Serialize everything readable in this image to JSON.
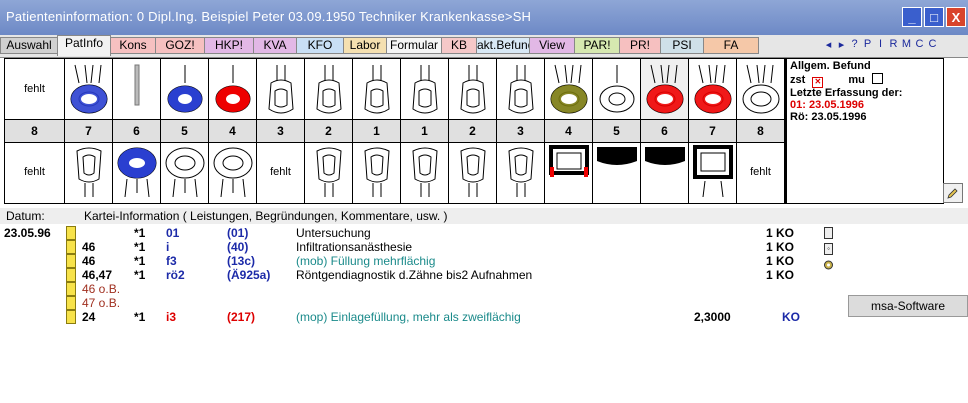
{
  "window": {
    "title": "Patienteninformation: 0  Dipl.Ing. Beispiel Peter  03.09.1950  Techniker Krankenkasse>SH",
    "buttons": [
      "_",
      "□",
      "X"
    ]
  },
  "tabs": [
    {
      "label": "Auswahl",
      "color": "#d0d0d0"
    },
    {
      "label": "PatInfo",
      "color": "#f2f2f2"
    },
    {
      "label": "Kons",
      "color": "#f6c0c0"
    },
    {
      "label": "GOZ!",
      "color": "#f6c0c0"
    },
    {
      "label": "HKP!",
      "color": "#e2b8e6"
    },
    {
      "label": "KVA",
      "color": "#e2b8e6"
    },
    {
      "label": "KFO",
      "color": "#c9dff5"
    },
    {
      "label": "Labor",
      "color": "#f5e0b0"
    },
    {
      "label": "Formular",
      "color": "#f5f5f5"
    },
    {
      "label": "KB",
      "color": "#f5c8c8"
    },
    {
      "label": "akt.Befund",
      "color": "#d8e8f5"
    },
    {
      "label": "View",
      "color": "#e2b8e6"
    },
    {
      "label": "PAR!",
      "color": "#d6e8b0"
    },
    {
      "label": "PR!",
      "color": "#f6c0c0"
    },
    {
      "label": "PSI",
      "color": "#cfe0e8"
    },
    {
      "label": "FA",
      "color": "#f5c8a8"
    }
  ],
  "nav_icons": [
    "◂",
    "▸",
    "?",
    "P",
    "I",
    "R",
    "M",
    "C",
    "C"
  ],
  "chart": {
    "upper_fehlt": "fehlt",
    "lower_fehlt": "fehlt",
    "lower_fehlt_mid": "fehlt",
    "lower_fehlt_right": "fehlt",
    "numbers": [
      "8",
      "7",
      "6",
      "5",
      "4",
      "3",
      "2",
      "1",
      "1",
      "2",
      "3",
      "4",
      "5",
      "6",
      "7",
      "8"
    ]
  },
  "befund": {
    "title": "Allgem. Befund",
    "zst_label": "zst",
    "mu_label": "mu",
    "letzte": "Letzte Erfassung der:",
    "date01": "01: 23.05.1996",
    "roe": "Rö: 23.05.1996"
  },
  "kartei_header": {
    "datum_label": "Datum:",
    "info_label": "Kartei-Information ( Leistungen, Begründungen, Kommentare, usw. )"
  },
  "entries": [
    {
      "date": "23.05.96",
      "tooth": "",
      "mult": "*1",
      "code": "01",
      "nr": "(01)",
      "text": "Untersuchung",
      "amount": "",
      "unit": "1 KO"
    },
    {
      "date": "",
      "tooth": "46",
      "mult": "*1",
      "code": "i",
      "nr": "(40)",
      "text": "Infiltrationsanästhesie",
      "amount": "",
      "unit": "1 KO"
    },
    {
      "date": "",
      "tooth": "46",
      "mult": "*1",
      "code": "f3",
      "nr": "(13c)",
      "text": "(mob) Füllung mehrflächig",
      "amount": "",
      "unit": "1 KO"
    },
    {
      "date": "",
      "tooth": "46,47",
      "mult": "*1",
      "code": "rö2",
      "nr": "(Ä925a)",
      "text": "Röntgendiagnostik d.Zähne bis2 Aufnahmen",
      "amount": "",
      "unit": "1 KO"
    },
    {
      "date": "",
      "tooth": "46 o.B.",
      "mult": "",
      "code": "",
      "nr": "",
      "text": "",
      "amount": "",
      "unit": ""
    },
    {
      "date": "",
      "tooth": "47 o.B.",
      "mult": "",
      "code": "",
      "nr": "",
      "text": "",
      "amount": "",
      "unit": ""
    },
    {
      "date": "",
      "tooth": "24",
      "mult": "*1",
      "code": "i3",
      "nr": "(217)",
      "text": "(mop) Einlagefüllung, mehr als zweiflächig",
      "amount": "2,3000",
      "unit": "KO"
    }
  ],
  "side_button": "msa-Software"
}
